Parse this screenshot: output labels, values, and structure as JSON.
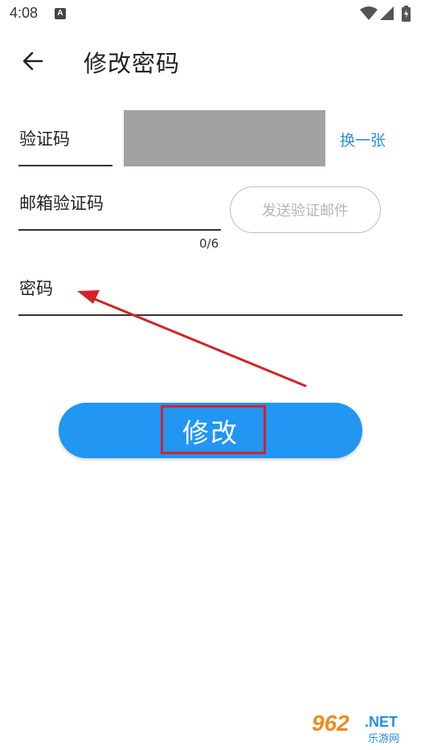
{
  "status_bar": {
    "time": "4:08",
    "notification_glyph": "A"
  },
  "header": {
    "title": "修改密码",
    "back_icon": "arrow-left-icon"
  },
  "form": {
    "captcha": {
      "label": "验证码",
      "refresh_label": "换一张"
    },
    "email_code": {
      "label": "邮箱验证码",
      "send_button_label": "发送验证邮件",
      "counter": "0/6"
    },
    "password": {
      "label": "密码"
    }
  },
  "submit": {
    "label": "修改"
  },
  "annotation": {
    "color": "#d3232a"
  },
  "colors": {
    "primary": "#2196f3",
    "link": "#2a8ee0"
  },
  "watermark": {
    "number": "962",
    "suffix": ".NET",
    "name": "乐游网"
  }
}
